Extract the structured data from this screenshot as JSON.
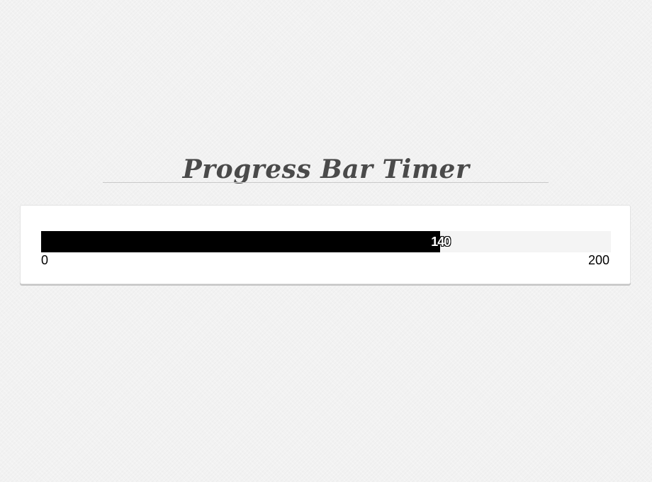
{
  "page": {
    "title": "Progress Bar Timer"
  },
  "progress": {
    "min": 0,
    "max": 200,
    "value": 140,
    "min_label": "0",
    "max_label": "200",
    "value_label": "140",
    "fill_color": "#000000",
    "track_color": "#f4f4f4"
  }
}
